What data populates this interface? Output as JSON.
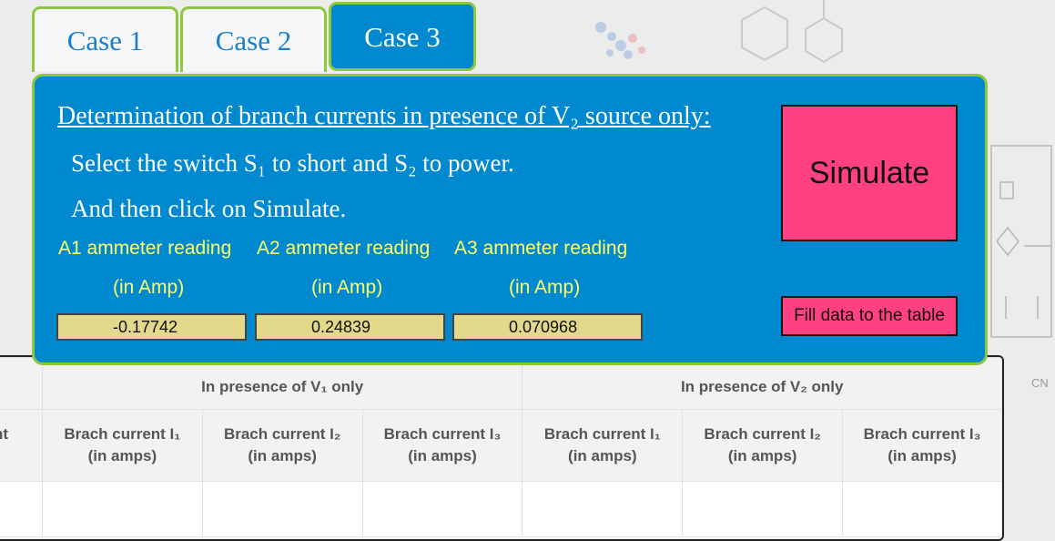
{
  "tabs": [
    "Case 1",
    "Case 2",
    "Case 3"
  ],
  "panel": {
    "title": "Determination of branch currents in presence of V₂ source only:",
    "instruction_1": "Select the switch S₁ to short and S₂ to power.",
    "instruction_2": "And then click on Simulate.",
    "meters": [
      {
        "label": "A1 ammeter reading",
        "unit": "(in Amp)",
        "value": "-0.17742"
      },
      {
        "label": "A2 ammeter reading",
        "unit": "(in Amp)",
        "value": "0.24839"
      },
      {
        "label": "A3 ammeter reading",
        "unit": "(in Amp)",
        "value": "0.070968"
      }
    ],
    "simulate_label": "Simulate",
    "fill_label": "Fill data to the table"
  },
  "table": {
    "group_headers": [
      "In presence of V₁ only",
      "In presence of V₂ only"
    ],
    "partial_header": "nt\n)",
    "columns": [
      "Brach current I₁\n(in amps)",
      "Brach current I₂\n(in amps)",
      "Brach current I₃\n(in amps)",
      "Brach current I₁\n(in amps)",
      "Brach current I₂\n(in amps)",
      "Brach current I₃\n(in amps)"
    ]
  },
  "colors": {
    "panel_blue": "#0089cf",
    "tab_border_green": "#8dc63f",
    "button_pink": "#ff4081",
    "meter_label_yellow": "#ffff66",
    "meter_box": "#e3d98a"
  }
}
